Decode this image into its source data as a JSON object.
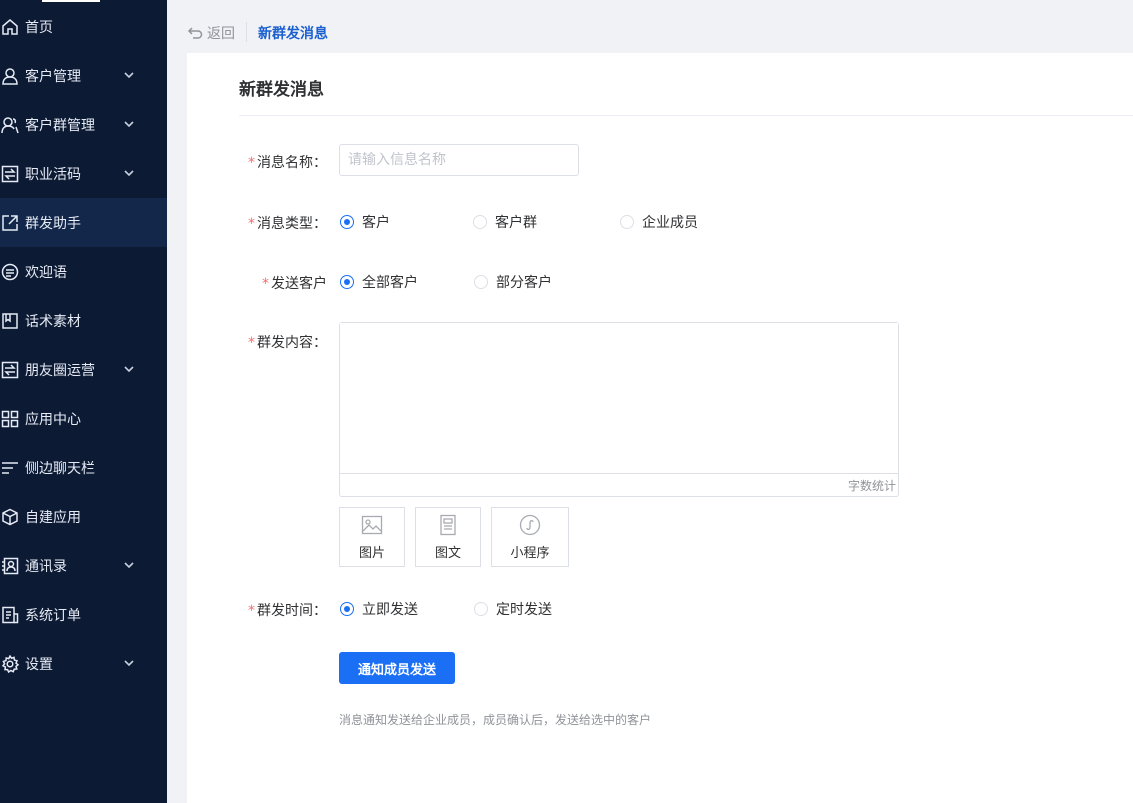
{
  "sidebar": {
    "items": [
      {
        "label": "首页",
        "icon": "home-icon",
        "has_arrow": false
      },
      {
        "label": "客户管理",
        "icon": "user-icon",
        "has_arrow": true
      },
      {
        "label": "客户群管理",
        "icon": "users-icon",
        "has_arrow": true
      },
      {
        "label": "职业活码",
        "icon": "exchange-icon",
        "has_arrow": true
      },
      {
        "label": "群发助手",
        "icon": "share-icon",
        "has_arrow": false,
        "active": true
      },
      {
        "label": "欢迎语",
        "icon": "message-icon",
        "has_arrow": false
      },
      {
        "label": "话术素材",
        "icon": "book-icon",
        "has_arrow": false
      },
      {
        "label": "朋友圈运营",
        "icon": "exchange-icon",
        "has_arrow": true
      },
      {
        "label": "应用中心",
        "icon": "grid-icon",
        "has_arrow": false
      },
      {
        "label": "侧边聊天栏",
        "icon": "menu-icon",
        "has_arrow": false
      },
      {
        "label": "自建应用",
        "icon": "box-icon",
        "has_arrow": false
      },
      {
        "label": "通讯录",
        "icon": "contacts-icon",
        "has_arrow": true
      },
      {
        "label": "系统订单",
        "icon": "order-icon",
        "has_arrow": false
      },
      {
        "label": "设置",
        "icon": "gear-icon",
        "has_arrow": true
      }
    ]
  },
  "breadcrumb": {
    "back_label": "返回",
    "current": "新群发消息"
  },
  "card": {
    "title": "新群发消息"
  },
  "form": {
    "name_label": "消息名称：",
    "name_placeholder": "请输入信息名称",
    "name_value": "",
    "type_label": "消息类型：",
    "type_options": [
      "客户",
      "客户群",
      "企业成员"
    ],
    "type_selected": "客户",
    "target_label": "发送客户",
    "target_options": [
      "全部客户",
      "部分客户"
    ],
    "target_selected": "全部客户",
    "content_label": "群发内容：",
    "content_value": "",
    "word_count_label": "字数统计",
    "attachments": [
      {
        "label": "图片",
        "icon": "image-icon"
      },
      {
        "label": "图文",
        "icon": "article-icon"
      },
      {
        "label": "小程序",
        "icon": "miniprogram-icon"
      }
    ],
    "time_label": "群发时间：",
    "time_options": [
      "立即发送",
      "定时发送"
    ],
    "time_selected": "立即发送",
    "submit_label": "通知成员发送",
    "hint": "消息通知发送给企业成员，成员确认后，发送给选中的客户"
  },
  "colors": {
    "sidebar_bg": "#0c1a33",
    "sidebar_active": "#13274a",
    "primary": "#1a6ff5",
    "required_star": "#f56c6c",
    "breadcrumb_current": "#1b5fd0"
  }
}
